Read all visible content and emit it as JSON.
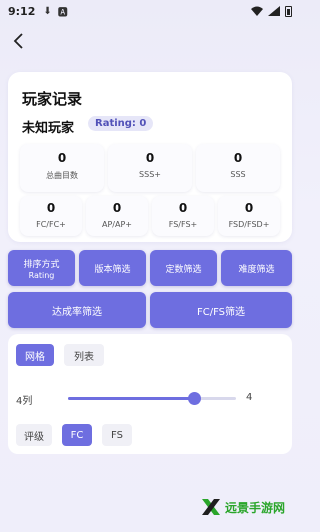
{
  "status_bar": {
    "time": "9:12",
    "icons": [
      "download-icon",
      "font-icon"
    ]
  },
  "header": {
    "back_icon": "chevron-left-icon"
  },
  "player_card": {
    "title": "玩家记录",
    "player_name": "未知玩家",
    "rating_label": "Rating: 0",
    "stats_primary": [
      {
        "value": "0",
        "label": "总曲目数"
      },
      {
        "value": "0",
        "label": "SSS+"
      },
      {
        "value": "0",
        "label": "SSS"
      }
    ],
    "stats_secondary": [
      {
        "value": "0",
        "label": "FC/FC+"
      },
      {
        "value": "0",
        "label": "AP/AP+"
      },
      {
        "value": "0",
        "label": "FS/FS+"
      },
      {
        "value": "0",
        "label": "FSD/FSD+"
      }
    ]
  },
  "filters": {
    "sort_label": "排序方式",
    "sort_value": "Rating",
    "version_label": "版本筛选",
    "constant_label": "定数筛选",
    "difficulty_label": "难度筛选",
    "achievement_label": "达成率筛选",
    "fcfs_label": "FC/FS筛选"
  },
  "view_panel": {
    "tabs": [
      {
        "label": "网格",
        "active": true
      },
      {
        "label": "列表",
        "active": false
      }
    ],
    "columns_label": "4列",
    "columns_value": "4",
    "column_level": 0.75,
    "badge_options": [
      {
        "label": "评级",
        "active": false
      },
      {
        "label": "FC",
        "active": true
      },
      {
        "label": "FS",
        "active": false
      }
    ]
  },
  "watermark": {
    "text": "远景手游网"
  },
  "colors": {
    "accent": "#6e6ee0",
    "badge_bg": "#e6e6f8",
    "watermark_green": "#2aa52a"
  }
}
